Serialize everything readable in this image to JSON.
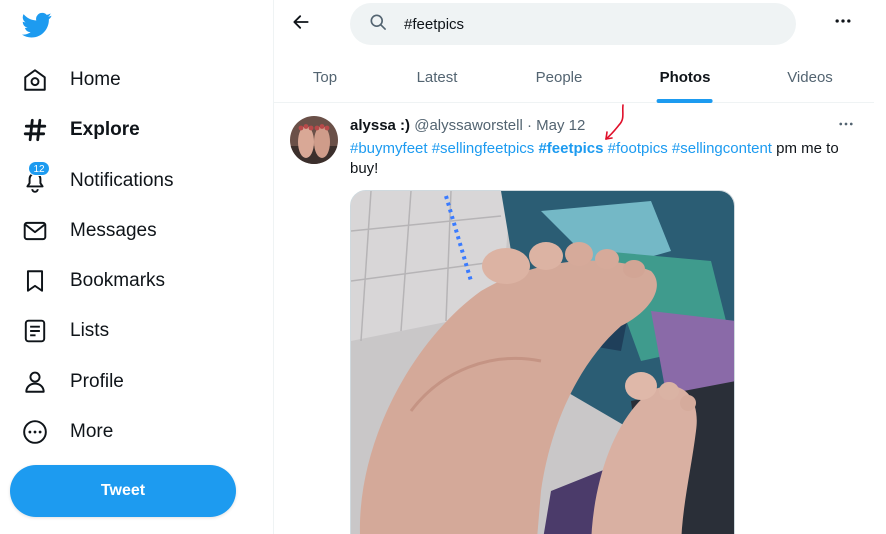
{
  "sidebar": {
    "logo": "twitter-bird-icon",
    "items": [
      {
        "label": "Home",
        "icon": "home-icon"
      },
      {
        "label": "Explore",
        "icon": "hashtag-icon",
        "active": true
      },
      {
        "label": "Notifications",
        "icon": "bell-icon",
        "badge": "12"
      },
      {
        "label": "Messages",
        "icon": "envelope-icon"
      },
      {
        "label": "Bookmarks",
        "icon": "bookmark-icon"
      },
      {
        "label": "Lists",
        "icon": "list-icon"
      },
      {
        "label": "Profile",
        "icon": "person-icon"
      },
      {
        "label": "More",
        "icon": "more-circle-icon"
      }
    ],
    "tweet_button": "Tweet"
  },
  "header": {
    "search_value": "#feetpics",
    "tabs": [
      {
        "label": "Top"
      },
      {
        "label": "Latest"
      },
      {
        "label": "People"
      },
      {
        "label": "Photos",
        "active": true
      },
      {
        "label": "Videos"
      }
    ]
  },
  "tweet": {
    "name": "alyssa :)",
    "handle": "@alyssaworstell",
    "separator": "·",
    "date": "May 12",
    "hashtags": [
      "#buymyfeet",
      "#sellingfeetpics",
      "#feetpics",
      "#footpics",
      "#sellingcontent"
    ],
    "text_after": "pm me to buy!"
  },
  "colors": {
    "accent": "#1d9bf0",
    "text_primary": "#0f1419",
    "text_secondary": "#536471",
    "annotation": "#e0102b"
  }
}
